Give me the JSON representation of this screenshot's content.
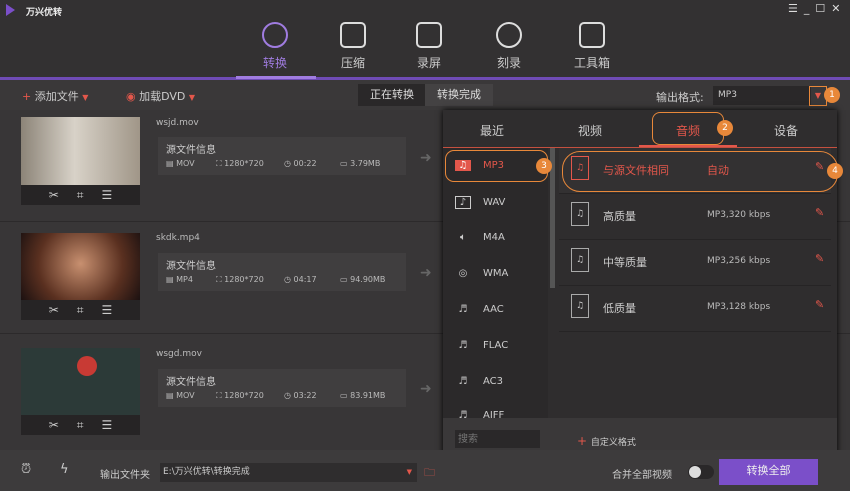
{
  "app": {
    "title": "万兴优转"
  },
  "window_controls": [
    "menu-icon",
    "minimize-icon",
    "maximize-icon",
    "close-icon"
  ],
  "nav": [
    {
      "label": "转换",
      "icon": "convert-icon",
      "active": true
    },
    {
      "label": "压缩",
      "icon": "compress-icon"
    },
    {
      "label": "录屏",
      "icon": "record-icon"
    },
    {
      "label": "刻录",
      "icon": "burn-icon"
    },
    {
      "label": "工具箱",
      "icon": "toolbox-icon"
    }
  ],
  "toolbar": {
    "add_file": "添加文件",
    "load_dvd": "加载DVD",
    "converting": "正在转换",
    "converted": "转换完成",
    "output_format_label": "输出格式:",
    "output_format_value": "MP3"
  },
  "files": [
    {
      "name": "wsjd.mov",
      "info_title": "源文件信息",
      "format": "MOV",
      "resolution": "1280*720",
      "duration": "00:22",
      "size": "3.79MB"
    },
    {
      "name": "skdk.mp4",
      "info_title": "源文件信息",
      "format": "MP4",
      "resolution": "1280*720",
      "duration": "04:17",
      "size": "94.90MB"
    },
    {
      "name": "wsgd.mov",
      "info_title": "源文件信息",
      "format": "MOV",
      "resolution": "1280*720",
      "duration": "03:22",
      "size": "83.91MB"
    }
  ],
  "popup": {
    "tabs": [
      "最近",
      "视频",
      "音频",
      "设备"
    ],
    "active_tab": "音频",
    "formats": [
      "MP3",
      "WAV",
      "M4A",
      "WMA",
      "AAC",
      "FLAC",
      "AC3",
      "AIFF"
    ],
    "selected_format": "MP3",
    "qualities": [
      {
        "name": "与源文件相同",
        "value": "自动",
        "icon_label": "SOURCE"
      },
      {
        "name": "高质量",
        "value": "MP3,320 kbps",
        "icon_label": "HIGH"
      },
      {
        "name": "中等质量",
        "value": "MP3,256 kbps",
        "icon_label": "MEDIUM"
      },
      {
        "name": "低质量",
        "value": "MP3,128 kbps",
        "icon_label": "LOW"
      }
    ],
    "search_placeholder": "搜索",
    "custom_format": "自定义格式"
  },
  "badges": [
    "1",
    "2",
    "3",
    "4"
  ],
  "bottom": {
    "output_folder_label": "输出文件夹",
    "output_folder_path": "E:\\万兴优转\\转换完成",
    "merge_label": "合并全部视频",
    "merge_on": false,
    "convert_all": "转换全部"
  },
  "colors": {
    "accent_purple": "#7b4fc9",
    "accent_orange": "#e8883a",
    "accent_red": "#e3574b"
  }
}
